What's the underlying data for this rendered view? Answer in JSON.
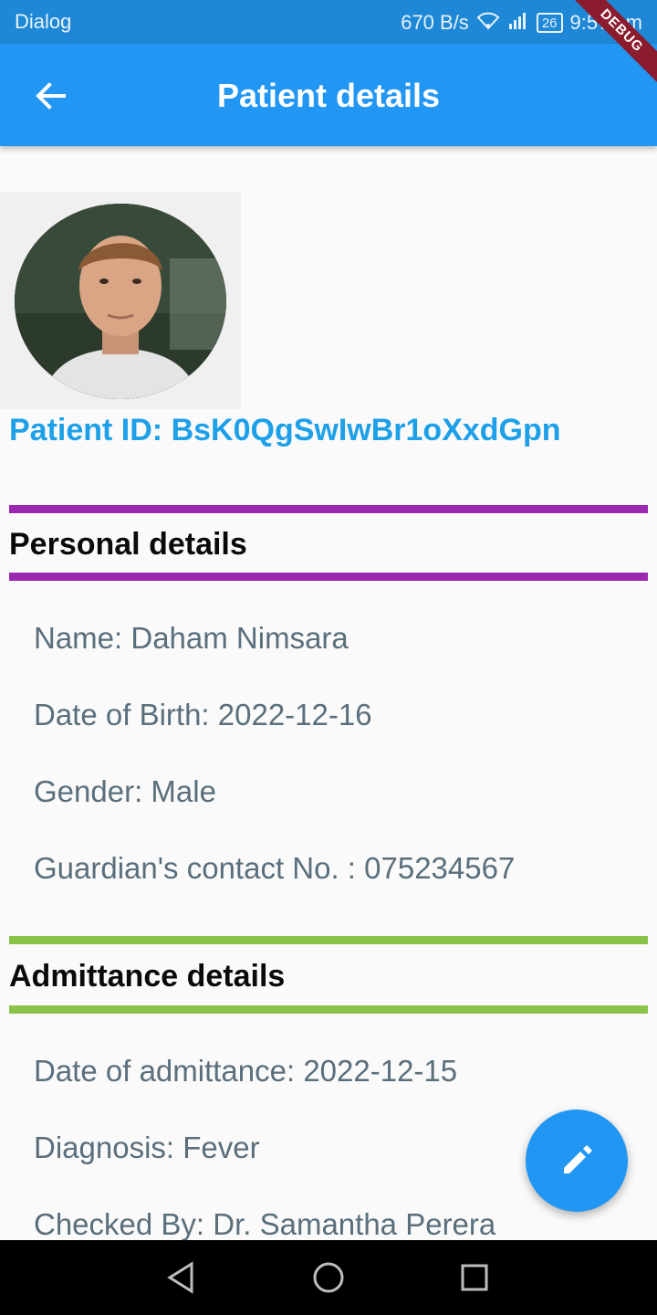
{
  "status_bar": {
    "carrier": "Dialog",
    "speed": "670 B/s",
    "battery": "26",
    "time": "9:57 am",
    "debug_label": "DEBUG"
  },
  "app_bar": {
    "title": "Patient details",
    "back_icon": "arrow-back-icon"
  },
  "patient": {
    "id_label": "Patient ID: BsK0QgSwIwBr1oXxdGpn"
  },
  "sections": {
    "personal": {
      "title": "Personal details",
      "color": "#9c27b0",
      "items": [
        "Name: Daham Nimsara",
        "Date of Birth: 2022-12-16",
        "Gender: Male",
        "Guardian's contact No. : 075234567"
      ]
    },
    "admittance": {
      "title": "Admittance details",
      "color": "#8bc34a",
      "items": [
        "Date of admittance: 2022-12-15",
        "Diagnosis: Fever",
        "Checked By: Dr. Samantha Perera"
      ]
    }
  },
  "fab": {
    "icon": "edit-icon",
    "color": "#2196f3"
  },
  "nav_bar": {
    "icons": [
      "back-triangle-icon",
      "home-circle-icon",
      "recents-square-icon"
    ]
  }
}
